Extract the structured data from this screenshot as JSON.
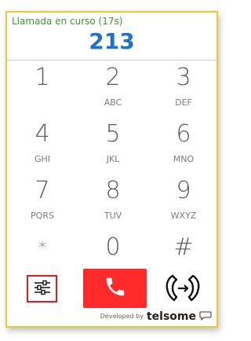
{
  "call": {
    "status": "Llamada en curso (17s)",
    "number": "213"
  },
  "keypad": [
    {
      "digit": "1",
      "letters": ""
    },
    {
      "digit": "2",
      "letters": "ABC"
    },
    {
      "digit": "3",
      "letters": "DEF"
    },
    {
      "digit": "4",
      "letters": "GHI"
    },
    {
      "digit": "5",
      "letters": "JKL"
    },
    {
      "digit": "6",
      "letters": "MNO"
    },
    {
      "digit": "7",
      "letters": "PQRS"
    },
    {
      "digit": "8",
      "letters": "TUV"
    },
    {
      "digit": "9",
      "letters": "WXYZ"
    },
    {
      "digit": "*",
      "letters": ""
    },
    {
      "digit": "0",
      "letters": ""
    },
    {
      "digit": "#",
      "letters": ""
    }
  ],
  "actions": {
    "settings_icon": "sliders-icon",
    "hangup_icon": "phone-icon",
    "transfer_icon": "call-transfer-icon"
  },
  "footer": {
    "developed_by": "Developed by",
    "brand_prefix": "telsome",
    "brand_icon": "speech-bubble-icon"
  },
  "colors": {
    "border": "#e3cf2b",
    "status_text": "#3a9a2f",
    "number_text": "#1e73c8",
    "hangup": "#ff2a2a",
    "settings_border": "#e01b1b"
  }
}
